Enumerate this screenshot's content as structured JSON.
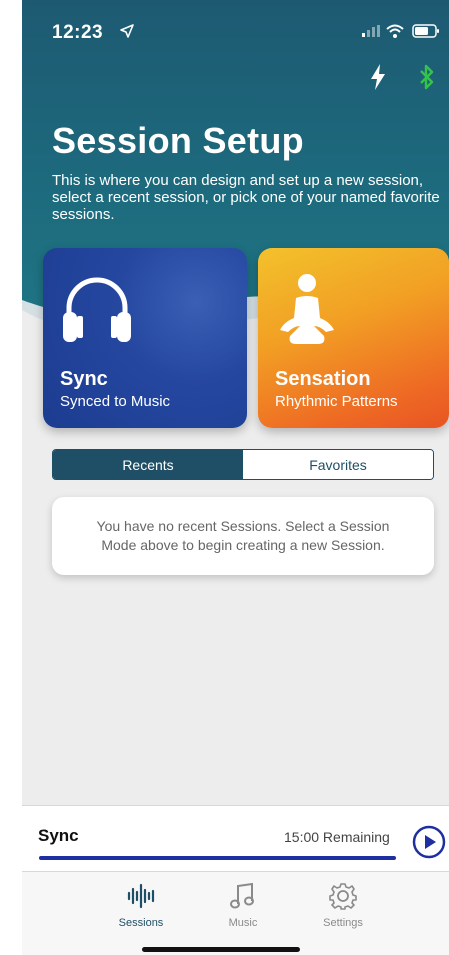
{
  "status_bar": {
    "time": "12:23"
  },
  "header": {
    "title": "Session Setup",
    "subtitle": "This is where you can design and set up a new session, select a recent session, or pick one of your named favorite sessions."
  },
  "modes": [
    {
      "title": "Sync",
      "subtitle": "Synced to Music",
      "icon": "headphones-icon"
    },
    {
      "title": "Sensation",
      "subtitle": "Rhythmic Patterns",
      "icon": "meditation-person-icon"
    }
  ],
  "segmented": {
    "recents": "Recents",
    "favorites": "Favorites",
    "selected": "Recents"
  },
  "empty_state": {
    "message": "You have no recent Sessions. Select a Session Mode above to begin creating a new Session."
  },
  "player": {
    "title": "Sync",
    "remaining": "15:00  Remaining",
    "progress": 1.0
  },
  "tabs": [
    {
      "label": "Sessions",
      "icon": "waveform-icon",
      "active": true
    },
    {
      "label": "Music",
      "icon": "music-note-icon",
      "active": false
    },
    {
      "label": "Settings",
      "icon": "gear-icon",
      "active": false
    }
  ],
  "colors": {
    "header": "#1d6b7e",
    "accent": "#1f4f66",
    "sync_card": "#2547a0",
    "sensation_card": "#f2a024",
    "bluetooth": "#35c24a",
    "player_accent": "#1f2fa0"
  }
}
